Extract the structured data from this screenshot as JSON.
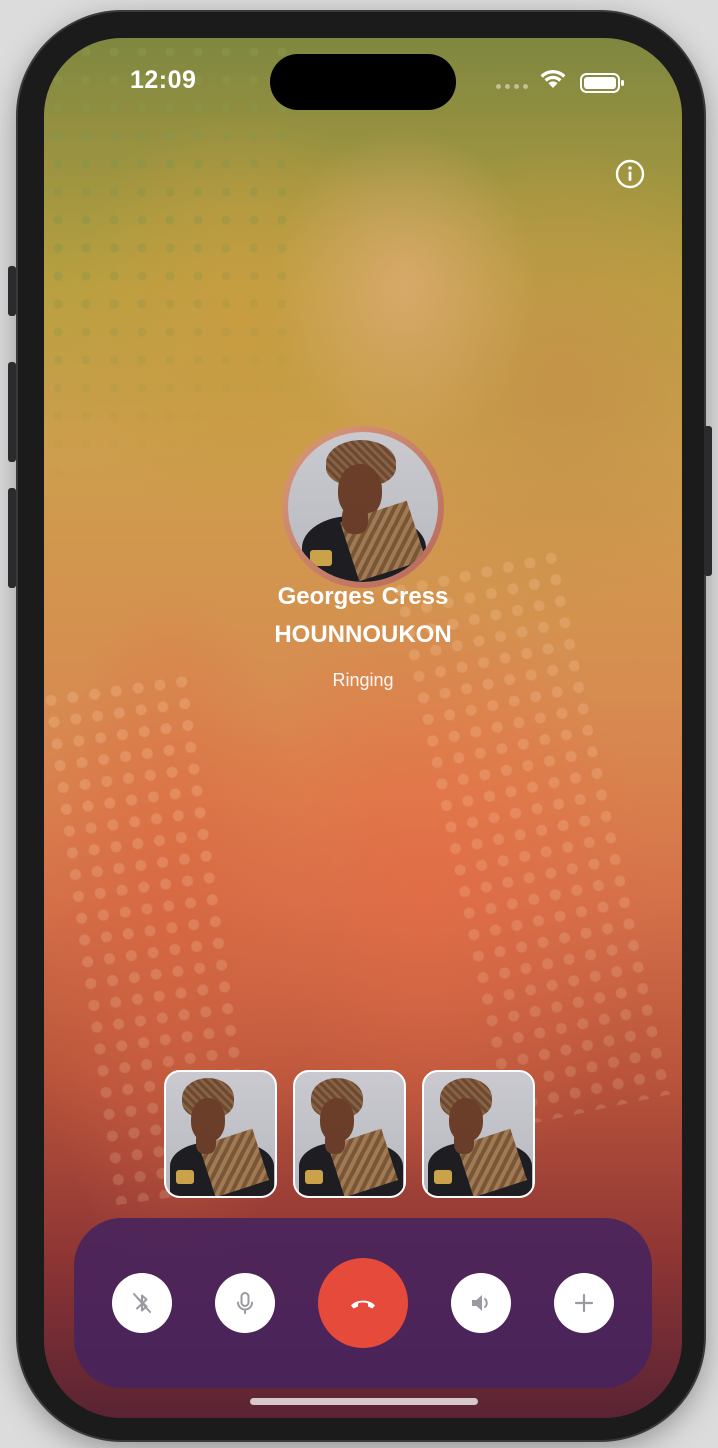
{
  "status_bar": {
    "time": "12:09"
  },
  "caller": {
    "name_line1": "Georges Cress",
    "name_line2": "HOUNNOUKON",
    "status": "Ringing"
  },
  "participants": [
    {
      "name": "participant-1"
    },
    {
      "name": "participant-2"
    },
    {
      "name": "participant-3"
    }
  ],
  "controls": [
    {
      "icon": "bluetooth-off-icon"
    },
    {
      "icon": "microphone-icon"
    },
    {
      "icon": "end-call-icon"
    },
    {
      "icon": "speaker-icon"
    },
    {
      "icon": "plus-icon"
    }
  ],
  "colors": {
    "end_call": "#e64a3a",
    "control_bar": "#46235f",
    "control_button": "#ffffff"
  }
}
